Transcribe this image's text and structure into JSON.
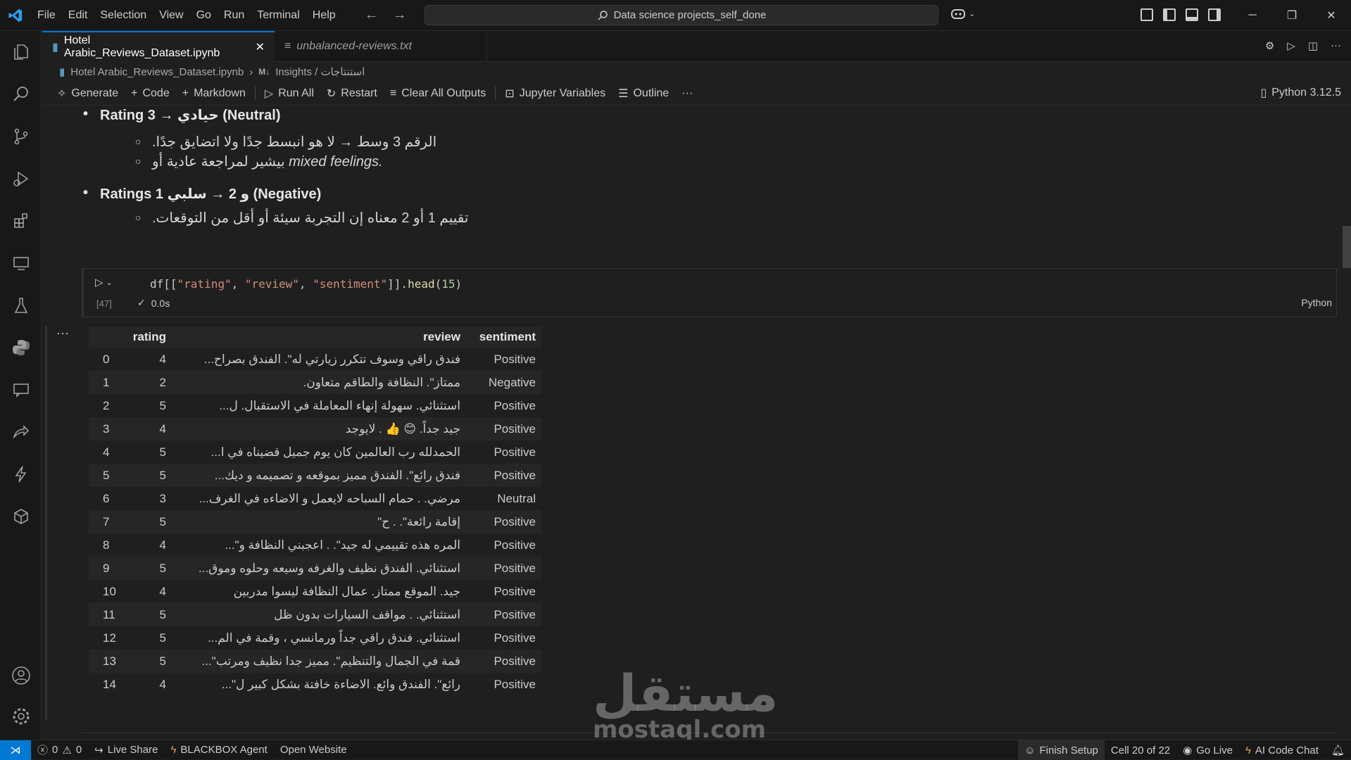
{
  "menu": [
    "File",
    "Edit",
    "Selection",
    "View",
    "Go",
    "Run",
    "Terminal",
    "Help"
  ],
  "search_text": "Data science projects_self_done",
  "tabs": [
    {
      "label": "Hotel Arabic_Reviews_Dataset.ipynb",
      "active": true
    },
    {
      "label": "unbalanced-reviews.txt",
      "active": false
    }
  ],
  "breadcrumb": {
    "file": "Hotel Arabic_Reviews_Dataset.ipynb",
    "md_badge": "M↓",
    "section": "Insights / استنتاجات"
  },
  "toolbar": {
    "generate": "Generate",
    "code": "Code",
    "markdown": "Markdown",
    "run_all": "Run All",
    "restart": "Restart",
    "clear_all": "Clear All Outputs",
    "variables": "Jupyter Variables",
    "outline": "Outline",
    "more": "···",
    "kernel": "Python 3.12.5"
  },
  "markdown": {
    "b1": "Rating 3 → حيادي (Neutral)",
    "b1_s1": "الرقم 3 وسط → لا هو انبسط جدًا ولا اتضايق جدًا.",
    "b1_s2_ar": "بيشير لمراجعة عادية أو",
    "b1_s2_en": "mixed feelings.",
    "b2": "Ratings 1 و 2 → سلبي (Negative)",
    "b2_s1": "تقييم 1 أو 2 معناه إن التجربة سيئة أو أقل من التوقعات."
  },
  "cell": {
    "code_prefix": "df[[",
    "code_s1": "\"rating\"",
    "code_s2": "\"review\"",
    "code_s3": "\"sentiment\"",
    "code_mid": "]].",
    "code_fn": "head",
    "code_num": "15",
    "exec_count": "[47]",
    "time": "0.0s",
    "language": "Python"
  },
  "table": {
    "headers": [
      "",
      "rating",
      "review",
      "sentiment"
    ],
    "rows": [
      [
        "0",
        "4",
        "فندق راقي وسوف تتكرر زيارتي له\". الفندق بصراح...",
        "Positive"
      ],
      [
        "1",
        "2",
        "ممتاز\". النظافة والطاقم متعاون.",
        "Negative"
      ],
      [
        "2",
        "5",
        "استثنائي. سهولة إنهاء المعاملة في الاستقبال. ل...",
        "Positive"
      ],
      [
        "3",
        "4",
        "جيد جداً. 😊 👍 . لايوجد",
        "Positive"
      ],
      [
        "4",
        "5",
        "الحمدلله رب العالمين كان يوم جميل قضيناه في ا...",
        "Positive"
      ],
      [
        "5",
        "5",
        "فندق رائع\". الفندق مميز بموقعه و تصميمه و ديك...",
        "Positive"
      ],
      [
        "6",
        "3",
        "مرضي. . حمام السباحه لايعمل و الاضاءه في الغرف...",
        "Neutral"
      ],
      [
        "7",
        "5",
        "إقامة رائعة\". . ح\"",
        "Positive"
      ],
      [
        "8",
        "4",
        "المره هذه تقييمي له جيد\". . اعجبني النظافة و\"...",
        "Positive"
      ],
      [
        "9",
        "5",
        "استثنائي. الفندق نظيف والغرفه وسيعه وحلوه وموق...",
        "Positive"
      ],
      [
        "10",
        "4",
        "جيد. الموقع ممتاز. عمال النظافة ليسوا مدربين",
        "Positive"
      ],
      [
        "11",
        "5",
        "استثنائي. . مواقف السيارات بدون ظل",
        "Positive"
      ],
      [
        "12",
        "5",
        "استثنائي. فندق راقي جداً ورمانسي ، وقمة في الم...",
        "Positive"
      ],
      [
        "13",
        "5",
        "قمة في الجمال والتنظيم\". مميز جدا نظيف ومرتب\"...",
        "Positive"
      ],
      [
        "14",
        "4",
        "رائع\". الفندق وائع. الاضاءة خافتة بشكل كبير ل\"...",
        "Positive"
      ]
    ]
  },
  "watermark": {
    "arabic": "مستقل",
    "latin": "mostaql.com"
  },
  "status": {
    "errors": "0",
    "warnings": "0",
    "live_share": "Live Share",
    "blackbox": "BLACKBOX Agent",
    "open_website": "Open Website",
    "finish_setup": "Finish Setup",
    "cell_pos": "Cell 20 of 22",
    "go_live": "Go Live",
    "ai_chat": "AI Code Chat"
  },
  "colors": {
    "accent": "#0078d4",
    "background": "#1f1f1f",
    "string": "#ce9178",
    "function": "#dcdcaa",
    "number": "#b5cea8"
  }
}
